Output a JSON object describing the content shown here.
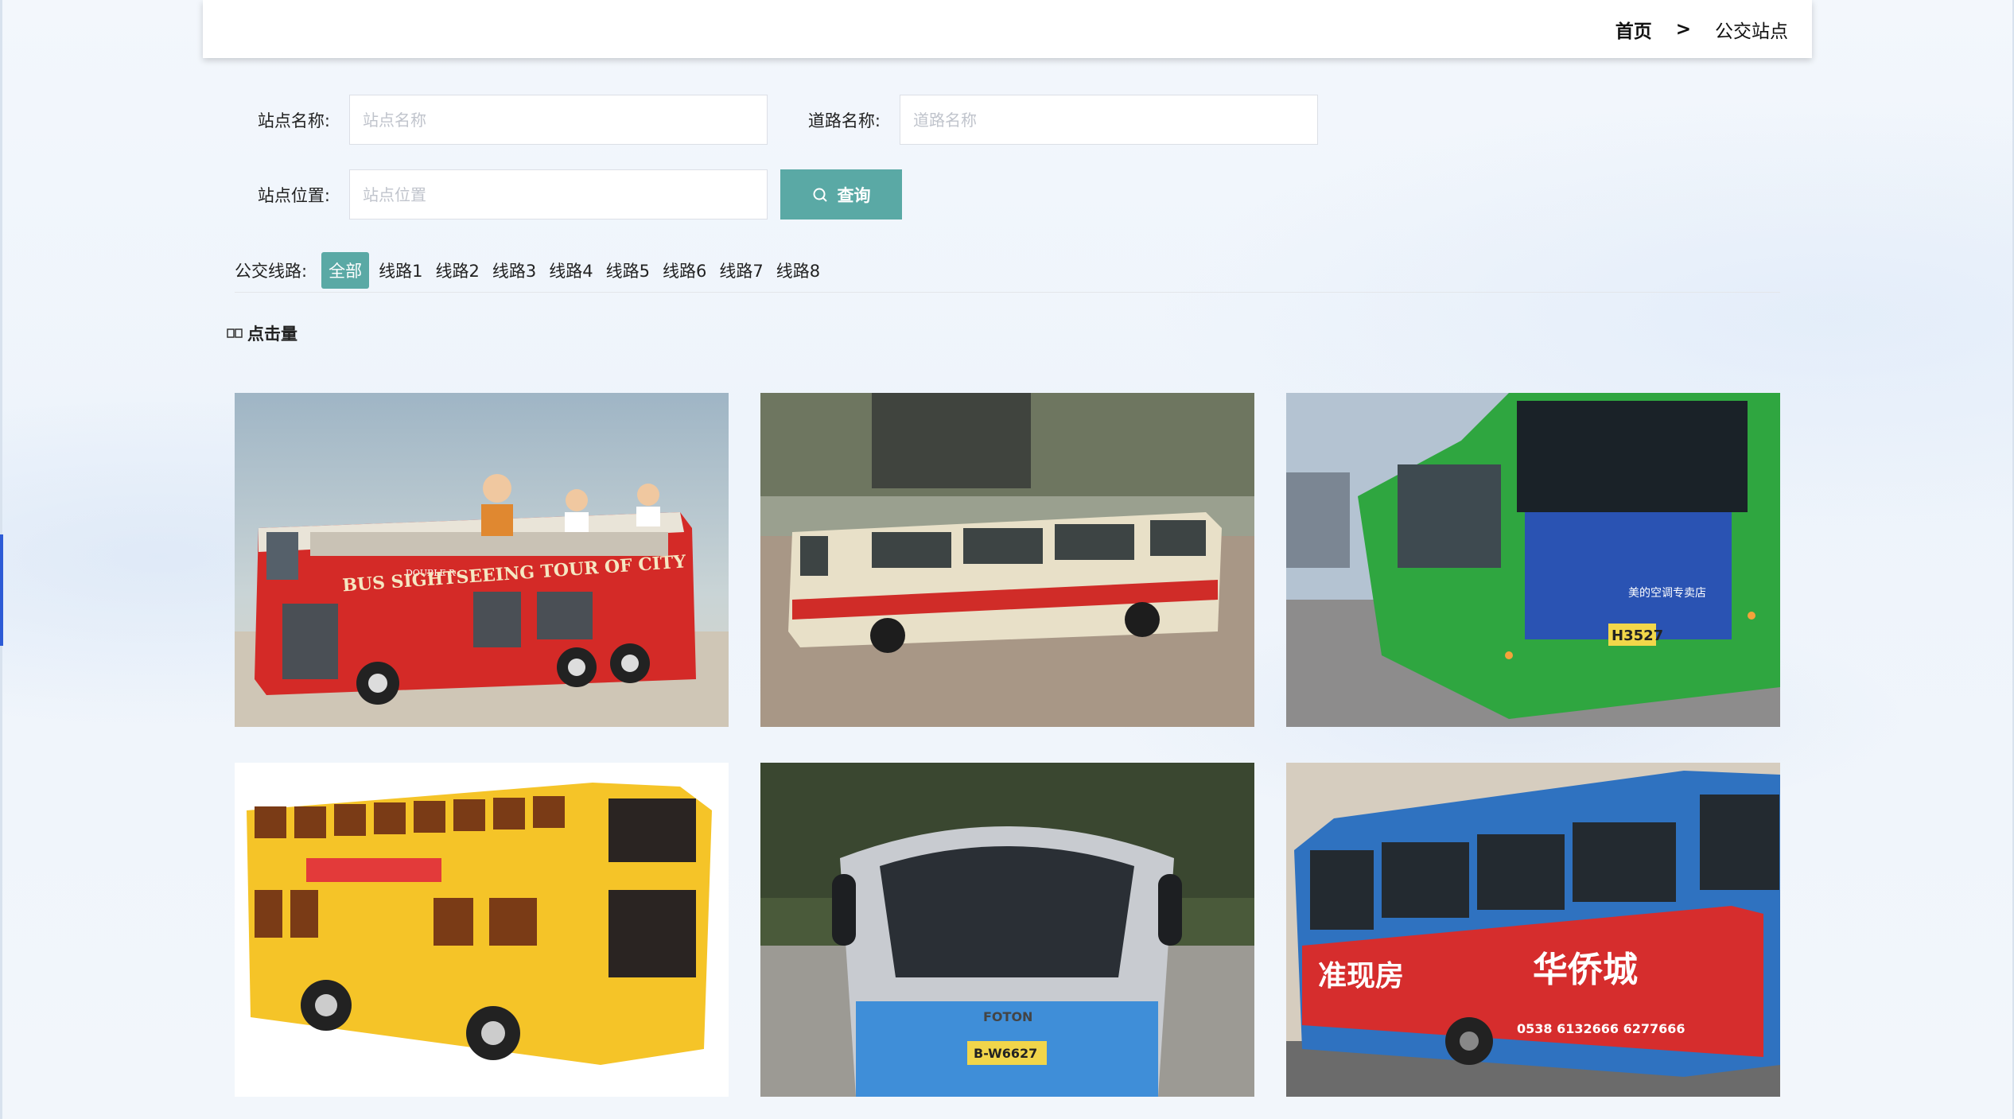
{
  "breadcrumb": {
    "home": "首页",
    "separator": ">",
    "current": "公交站点"
  },
  "form": {
    "station_name": {
      "label": "站点名称:",
      "placeholder": "站点名称"
    },
    "road_name": {
      "label": "道路名称:",
      "placeholder": "道路名称"
    },
    "station_location": {
      "label": "站点位置:",
      "placeholder": "站点位置"
    },
    "search_button": "查询"
  },
  "filter": {
    "label": "公交线路:",
    "options": [
      "全部",
      "线路1",
      "线路2",
      "线路3",
      "线路4",
      "线路5",
      "线路6",
      "线路7",
      "线路8"
    ],
    "active_index": 0
  },
  "sort": {
    "label": "点击量"
  },
  "theme": {
    "accent": "#5aa9a5",
    "nav_accent": "#2d5bd6"
  },
  "cards": [
    {
      "name": "red-double-decker-sightseeing-bus",
      "sign_text": "BUS SIGHTSEEING TOUR OF CITY",
      "top_text": "DOUBLE R"
    },
    {
      "name": "cream-red-vintage-bus"
    },
    {
      "name": "green-city-bus-rear",
      "plate_text": "H3527",
      "ad_text": "美的空调专卖店"
    },
    {
      "name": "yellow-double-decker-bus"
    },
    {
      "name": "blue-silver-bus-front",
      "brand_text": "FOTON",
      "plate_text": "B-W6627"
    },
    {
      "name": "blue-red-city-bus-ad",
      "ad_text_1": "准现房",
      "ad_text_2": "华侨城",
      "ad_phone": "0538 6132666  6277666"
    }
  ]
}
